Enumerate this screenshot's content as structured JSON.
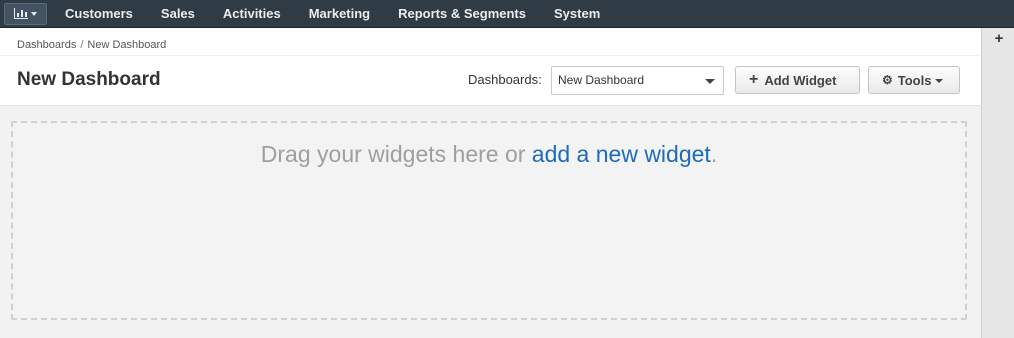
{
  "navbar": {
    "items": [
      "Customers",
      "Sales",
      "Activities",
      "Marketing",
      "Reports & Segments",
      "System"
    ]
  },
  "breadcrumb": {
    "root": "Dashboards",
    "separator": "/",
    "current": "New Dashboard"
  },
  "page": {
    "title": "New Dashboard"
  },
  "toolbar": {
    "dashboards_label": "Dashboards:",
    "dashboards_selected": "New Dashboard",
    "add_widget_label": "Add Widget",
    "tools_label": "Tools"
  },
  "dropzone": {
    "text_prefix": "Drag your widgets here or ",
    "link_text": "add a new widget",
    "text_suffix": "."
  },
  "icons": {
    "app": "bar-chart-icon",
    "add": "plus-icon",
    "tools": "gear-icon"
  },
  "colors": {
    "navbar": "#2f3b45",
    "link": "#1e6bb8",
    "drop_text": "#9f9f9f"
  }
}
